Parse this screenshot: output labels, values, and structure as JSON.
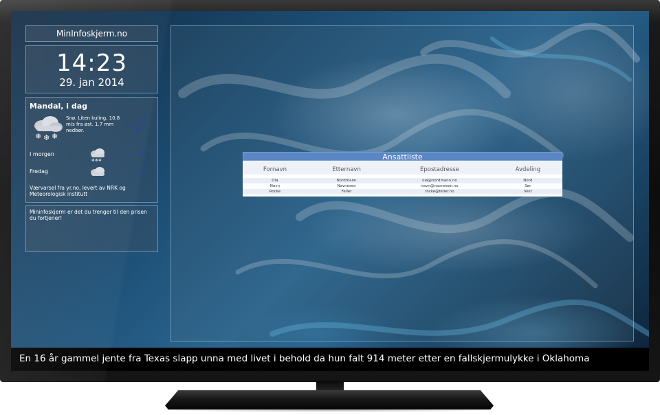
{
  "brand": {
    "title": "MinInfoskjerm.no"
  },
  "clock": {
    "time": "14:23",
    "date": "29. jan 2014"
  },
  "weather": {
    "title": "Mandal, i dag",
    "today": {
      "description": "Snø. Liten kuling, 10.8 m/s fra øst. 1.7 mm nedbør.",
      "temperature": "-1°",
      "icon": "snow-cloud-icon"
    },
    "forecast": [
      {
        "day": "I morgen",
        "temperature": "-2°",
        "icon": "snow-cloud-icon"
      },
      {
        "day": "Fredag",
        "temperature": "-1°",
        "icon": "cloud-icon"
      }
    ],
    "credit": "Værvarsel fra yr.no, levert av NRK og Meteorologisk institutt",
    "temperature_color": "#1a35d8"
  },
  "promo": {
    "text": "Mininfoskjerm er det du trenger til den prisen du fortjener!"
  },
  "staff_list": {
    "title": "Ansattliste",
    "headers": [
      "Fornavn",
      "Etternavn",
      "Epostadresse",
      "Avdeling"
    ],
    "rows": [
      [
        "Ola",
        "Nordmann",
        "ola@nordmann.no",
        "Nord"
      ],
      [
        "Navn",
        "Navnesen",
        "navn@navnesen.no",
        "Sør"
      ],
      [
        "Rocke",
        "Feller",
        "rocke@feller.no",
        "Vest"
      ]
    ],
    "header_color": "#5a86c4"
  },
  "ticker": {
    "text": "En 16 år gammel jente fra Texas slapp unna med livet i behold da hun falt 914 meter etter en fallskjermulykke i Oklahoma"
  }
}
